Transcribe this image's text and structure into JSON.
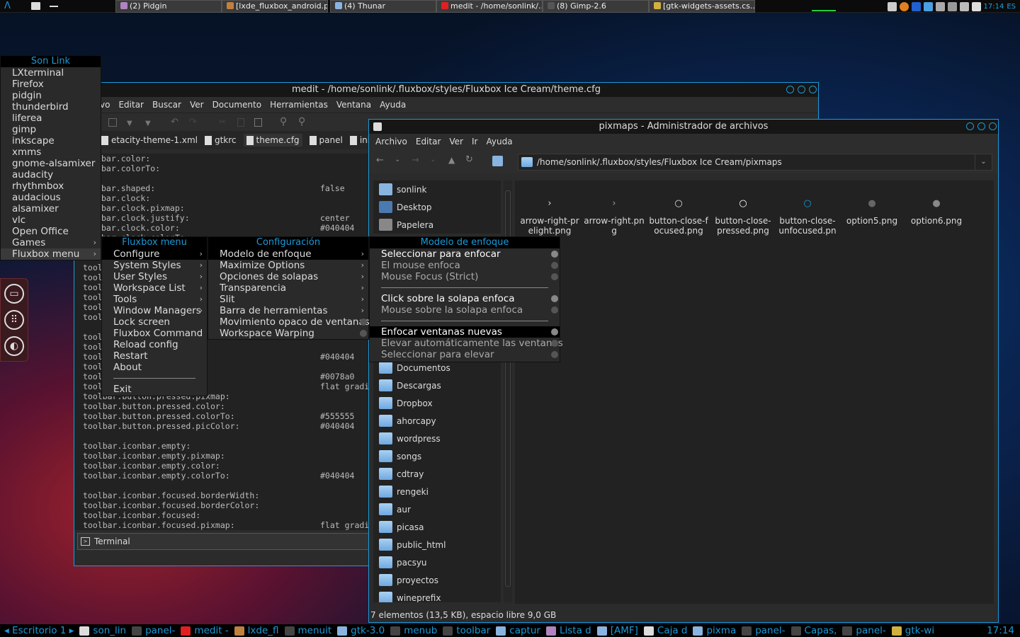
{
  "topbar": {
    "tasks": [
      {
        "label": "(2) Pidgin",
        "color": "#b084c0"
      },
      {
        "label": "[lxde_fluxbox_android.p...",
        "color": "#c08040"
      },
      {
        "label": "(4) Thunar",
        "color": "#8ab4e0"
      },
      {
        "label": "medit - /home/sonlink/...",
        "color": "#e02020"
      },
      {
        "label": "(8) Gimp-2.6",
        "color": "#555555"
      },
      {
        "label": "[gtk-widgets-assets.cs...",
        "color": "#d0b040"
      }
    ],
    "clock": "17:14",
    "lang": "ES"
  },
  "favorites": {
    "title": "Son Link",
    "items": [
      "LXterminal",
      "Firefox",
      "pidgin",
      "thunderbird",
      "liferea",
      "gimp",
      "inkscape",
      "xmms",
      "gnome-alsamixer",
      "audacity",
      "rhythmbox",
      "audacious",
      "alsamixer",
      "vlc",
      "Open Office",
      "Games",
      "Fluxbox menu"
    ]
  },
  "medit": {
    "title": "medit - /home/sonlink/.fluxbox/styles/Fluxbox Ice Cream/theme.cfg",
    "menu": [
      "vo",
      "Editar",
      "Buscar",
      "Ver",
      "Documento",
      "Herramientas",
      "Ventana",
      "Ayuda"
    ],
    "tabs": [
      "etacity-theme-1.xml",
      "gtkrc",
      "theme.cfg",
      "panel",
      "init"
    ],
    "code_top": [
      "bar.color:",
      "bar.colorTo:",
      "",
      "bar.shaped:",
      "bar.clock:",
      "bar.clock.pixmap:",
      "bar.clock.justify:",
      "bar.clock.color:",
      "bar.clock.colorTo:"
    ],
    "code_top_vals": [
      "",
      "",
      "",
      "false",
      "",
      "",
      "center",
      "#040404",
      ""
    ],
    "code_bottom": [
      "toolbar.button.pressed.pixmap:",
      "toolbar.button.pressed.color:",
      "toolbar.button.pressed.colorTo:",
      "toolbar.button.pressed.picColor:",
      "",
      "toolbar.iconbar.empty:",
      "toolbar.iconbar.empty.pixmap:",
      "toolbar.iconbar.empty.color:",
      "toolbar.iconbar.empty.colorTo:",
      "",
      "toolbar.iconbar.focused.borderWidth:",
      "toolbar.iconbar.focused.borderColor:",
      "toolbar.iconbar.focused:",
      "toolbar.iconbar.focused.pixmap:"
    ],
    "code_bottom_vals": [
      "",
      "#555555",
      "#040404",
      "",
      "",
      "",
      "",
      "#040404",
      "",
      "",
      "",
      "",
      "flat gradi",
      ""
    ],
    "mid_vals": [
      "#040404",
      "",
      "#0078a0",
      "flat gradi"
    ],
    "tool_prefix": "tool",
    "terminal": "Terminal"
  },
  "fluxmenu": {
    "title": "Fluxbox menu",
    "items": [
      "Configure",
      "System Styles",
      "User Styles",
      "Workspace List",
      "Tools",
      "Window Managers",
      "Lock screen",
      "Fluxbox Command",
      "Reload config",
      "Restart",
      "About"
    ],
    "exit": "Exit"
  },
  "config": {
    "title": "Configuración",
    "items": [
      "Modelo de enfoque",
      "Maximize Options",
      "Opciones de solapas",
      "Transparencia",
      "Slit",
      "Barra de herramientas",
      "Movimiento opaco de ventanas",
      "Workspace Warping"
    ]
  },
  "focus": {
    "title": "Modelo de enfoque",
    "group1": [
      "Seleccionar para enfocar",
      "El mouse enfoca",
      "Mouse Focus (Strict)"
    ],
    "group2": [
      "Click sobre la solapa enfoca",
      "Mouse sobre la solapa enfoca"
    ],
    "group3": [
      "Enfocar ventanas nuevas",
      "Elevar automáticamente las ventanas",
      "Seleccionar para elevar"
    ]
  },
  "thunar": {
    "title": "pixmaps - Administrador de archivos",
    "menu": [
      "Archivo",
      "Editar",
      "Ver",
      "Ir",
      "Ayuda"
    ],
    "path": "/home/sonlink/.fluxbox/styles/Fluxbox Ice Cream/pixmaps",
    "side_top": [
      "sonlink",
      "Desktop",
      "Papelera"
    ],
    "side_bottom": [
      "Documentos",
      "Descargas",
      "Dropbox",
      "ahorcapy",
      "wordpress",
      "songs",
      "cdtray",
      "rengeki",
      "aur",
      "picasa",
      "public_html",
      "pacsyu",
      "proyectos",
      "wineprefix"
    ],
    "files": [
      {
        "name": "arrow-right-prelight.png",
        "glyph": "›"
      },
      {
        "name": "arrow-right.png",
        "glyph": "›"
      },
      {
        "name": "button-close-focused.png",
        "glyph": "○"
      },
      {
        "name": "button-close-pressed.png",
        "glyph": "○"
      },
      {
        "name": "button-close-unfocused.png",
        "glyph": "○"
      },
      {
        "name": "option5.png",
        "glyph": "●"
      },
      {
        "name": "option6.png",
        "glyph": "●"
      }
    ],
    "status": "7 elementos (13,5 KB), espacio libre 9,0 GB"
  },
  "bottombar": {
    "items": [
      "◂ Escritorio 1 ▸",
      "son_lin",
      "panel-",
      "medit -",
      "lxde_fl",
      "menuit",
      "gtk-3.0",
      "menub",
      "toolbar",
      "captur",
      "Lista d",
      "[AMF]",
      "Caja d",
      "pixma",
      "panel-",
      "Capas,",
      "panel-",
      "gtk-wi"
    ],
    "clock": "17:14"
  }
}
